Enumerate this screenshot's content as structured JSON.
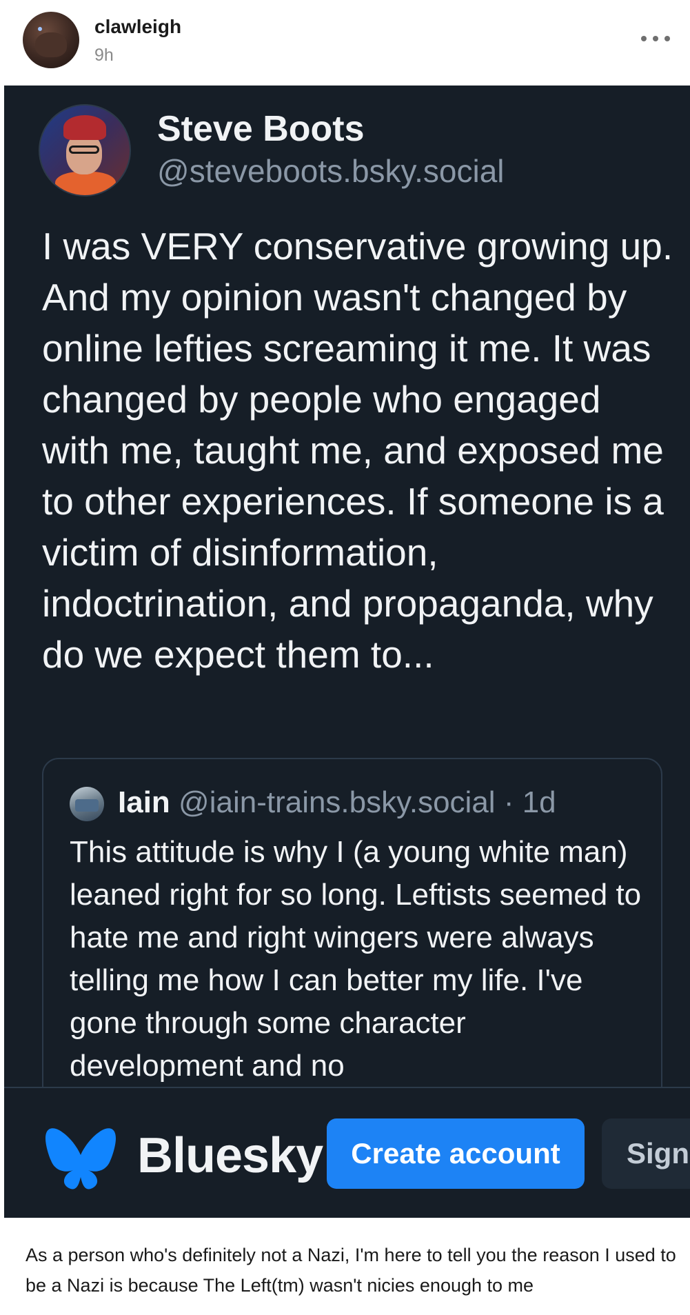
{
  "post": {
    "username": "clawleigh",
    "timestamp": "9h",
    "more_icon": "more-horizontal-icon"
  },
  "embed": {
    "author_name": "Steve Boots",
    "author_handle": "@steveboots.bsky.social",
    "text": "I was VERY conservative growing up. And my opinion wasn't changed by online lefties screaming it me. It was changed by people who engaged with me, taught me, and exposed me to other experiences. If someone is a victim of disinformation, indoctrination, and propaganda, why do we expect them to...",
    "quote": {
      "name": "Iain",
      "handle": "@iain-trains.bsky.social",
      "separator": " · ",
      "age": "1d",
      "text": "This attitude is why I (a young white man) leaned right for so long. Leftists seemed to hate me and right wingers were always telling me how I can better my life. I've gone through some character development and no"
    },
    "footer": {
      "brand": "Bluesky",
      "create_account": "Create account",
      "sign_in": "Sign"
    },
    "colors": {
      "card_bg": "#161e27",
      "accent": "#1d83f5",
      "butterfly": "#1185fe"
    }
  },
  "caption": "As a person who's definitely not a Nazi, I'm here to tell you the reason I used to be a Nazi is because The Left(tm) wasn't nicies enough to me"
}
